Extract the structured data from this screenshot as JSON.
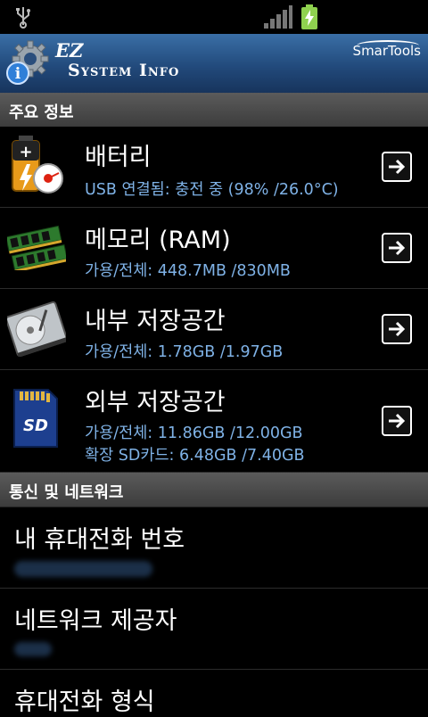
{
  "app": {
    "title_line1": "EZ",
    "title_line2": "System Info",
    "brand": "SmarTools"
  },
  "sections": {
    "main_info": "주요 정보",
    "network": "통신 및 네트워크"
  },
  "items": [
    {
      "name": "배터리",
      "sub": [
        "USB 연결됨: 충전 중 (98% /26.0°C)"
      ]
    },
    {
      "name": "메모리 (RAM)",
      "sub": [
        "가용/전체: 448.7MB /830MB"
      ]
    },
    {
      "name": "내부 저장공간",
      "sub": [
        "가용/전체: 1.78GB /1.97GB"
      ]
    },
    {
      "name": "외부 저장공간",
      "sub": [
        "가용/전체: 11.86GB /12.00GB",
        "확장 SD카드: 6.48GB /7.40GB"
      ]
    }
  ],
  "network_items": [
    {
      "name": "내 휴대전화 번호"
    },
    {
      "name": "네트워크 제공자"
    },
    {
      "name": "휴대전화 형식"
    }
  ],
  "colors": {
    "subtext": "#7fb2e6",
    "header": "#224a7c",
    "battery": "#8fd14f"
  }
}
